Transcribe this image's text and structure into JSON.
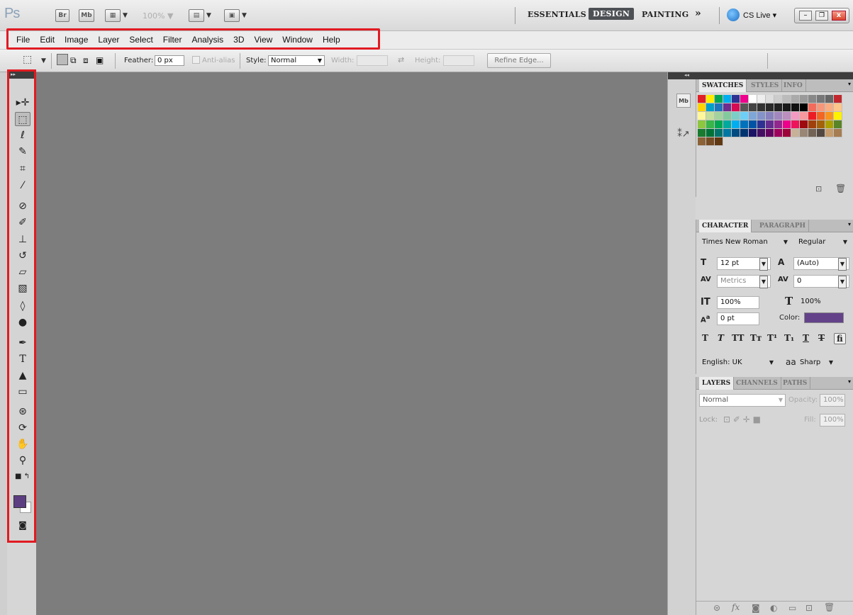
{
  "app": {
    "logo": "Ps",
    "bridge": "Br",
    "minibridge": "Mb",
    "zoom": "100%"
  },
  "workspaces": {
    "essentials": "ESSENTIALS",
    "design": "DESIGN",
    "painting": "PAINTING",
    "more": "»",
    "cslive": "CS Live"
  },
  "menu": [
    "File",
    "Edit",
    "Image",
    "Layer",
    "Select",
    "Filter",
    "Analysis",
    "3D",
    "View",
    "Window",
    "Help"
  ],
  "options": {
    "feather_label": "Feather:",
    "feather_value": "0 px",
    "antialias": "Anti-alias",
    "style_label": "Style:",
    "style_value": "Normal",
    "width_label": "Width:",
    "height_label": "Height:",
    "refine": "Refine Edge..."
  },
  "toolbar_icons": [
    "move-tool",
    "marquee-tool",
    "lasso-tool",
    "quick-select-tool",
    "crop-tool",
    "eyedropper-tool",
    "healing-brush-tool",
    "brush-tool",
    "clone-stamp-tool",
    "history-brush-tool",
    "eraser-tool",
    "gradient-tool",
    "blur-tool",
    "dodge-tool",
    "pen-tool",
    "type-tool",
    "path-select-tool",
    "shape-tool",
    "3d-rotate-tool",
    "3d-orbit-tool",
    "hand-tool",
    "zoom-tool"
  ],
  "colors": {
    "foreground": "#5c3d82",
    "background": "#ffffff",
    "char_color": "#63428a",
    "highlight": "#e11b22"
  },
  "swatches_panel": {
    "tabs": [
      "SWATCHES",
      "STYLES",
      "INFO"
    ]
  },
  "character_panel": {
    "tabs": [
      "CHARACTER",
      "PARAGRAPH"
    ],
    "font": "Times New Roman",
    "style": "Regular",
    "size": "12 pt",
    "leading": "(Auto)",
    "kerning": "Metrics",
    "tracking": "0",
    "vscale": "100%",
    "hscale": "100%",
    "baseline": "0 pt",
    "color_label": "Color:",
    "language": "English: UK",
    "aa_label": "a",
    "aa_value": "Sharp"
  },
  "layers_panel": {
    "tabs": [
      "LAYERS",
      "CHANNELS",
      "PATHS"
    ],
    "blend": "Normal",
    "opacity_label": "Opacity:",
    "opacity": "100%",
    "lock_label": "Lock:",
    "fill_label": "Fill:",
    "fill": "100%"
  }
}
